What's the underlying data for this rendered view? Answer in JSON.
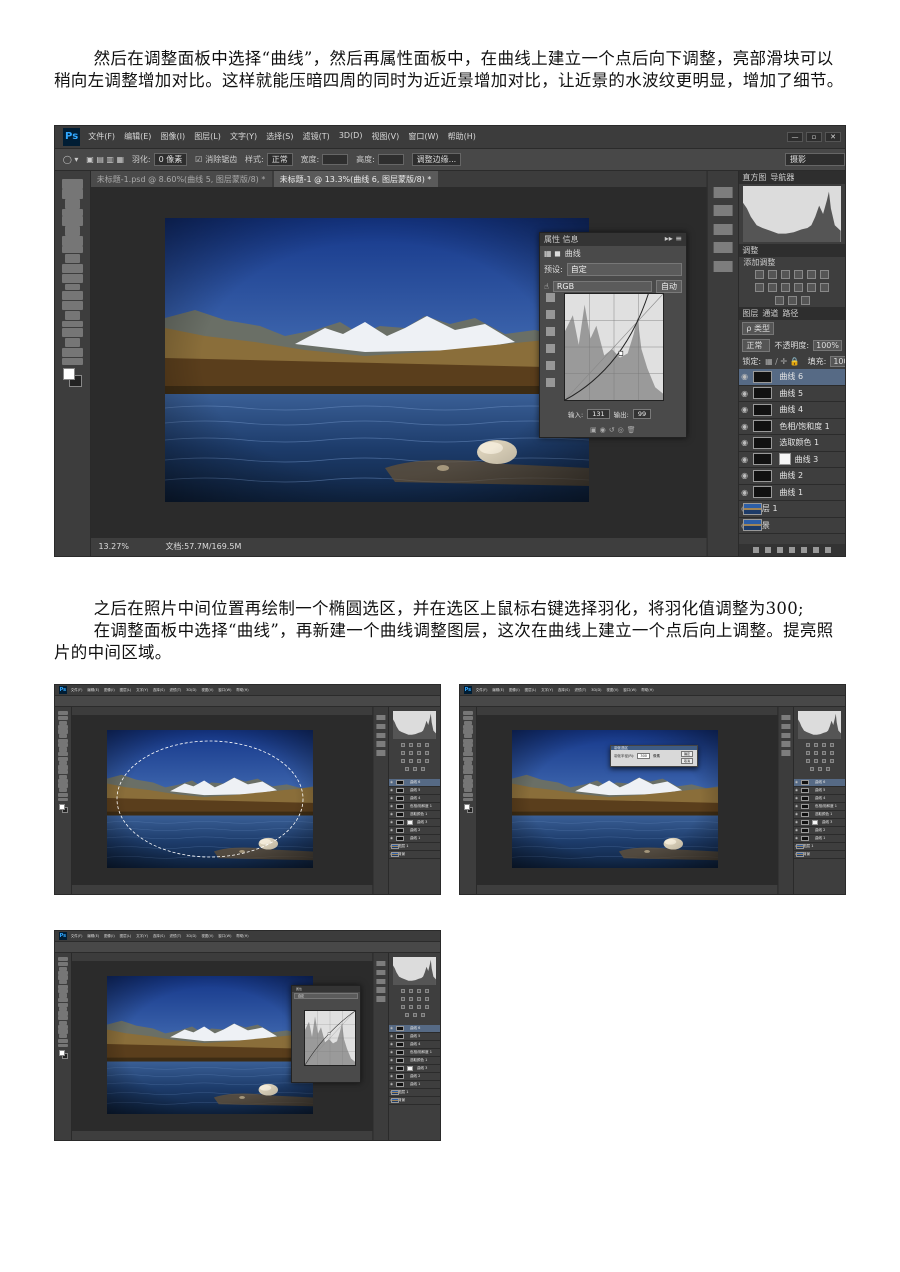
{
  "text": {
    "para1": "然后在调整面板中选择“曲线”，然后再属性面板中，在曲线上建立一个点后向下调整，亮部滑块可以稍向左调整增加对比。这样就能压暗四周的同时为近近景增加对比，让近景的水波纹更明显，增加了细节。",
    "para2_line1": "之后在照片中间位置再绘制一个椭圆选区，并在选区上鼠标右键选择羽化，将羽化值调整为300;",
    "para2_line2": "在调整面板中选择“曲线”，再新建一个曲线调整图层，这次在曲线上建立一个点后向上调整。提亮照片的中间区域。"
  },
  "app": {
    "logo": "Ps",
    "menus": [
      "文件(F)",
      "编辑(E)",
      "图像(I)",
      "图层(L)",
      "文字(Y)",
      "选择(S)",
      "滤镜(T)",
      "3D(D)",
      "视图(V)",
      "窗口(W)",
      "帮助(H)"
    ],
    "window_controls": [
      "—",
      "▫",
      "✕"
    ],
    "options": {
      "feather_label": "羽化:",
      "feather_value": "0 像素",
      "antialias": "消除锯齿",
      "style_label": "样式:",
      "style_value": "正常",
      "width_label": "宽度:",
      "height_label": "高度:",
      "refine_edge": "调整边缘...",
      "workspace": "摄影"
    },
    "tabs": [
      "未标题-1.psd @ 8.60%(曲线 5, 图层蒙版/8) *",
      "未标题-1 @ 13.3%(曲线 6, 图层蒙版/8) *"
    ],
    "status": {
      "zoom": "13.27%",
      "doc": "文档:57.7M/169.5M"
    },
    "panels": {
      "histogram_tabs": [
        "直方图",
        "导航器"
      ],
      "adjust_tab": "调整",
      "adjust_title": "添加调整",
      "layers_tabs": [
        "图层",
        "通道",
        "路径"
      ],
      "kind": "ρ 类型",
      "blend": "正常",
      "opacity_label": "不透明度:",
      "opacity": "100%",
      "lock_label": "锁定:",
      "fill_label": "填充:",
      "fill": "100%"
    },
    "layers": [
      {
        "name": "曲线 6",
        "thumb": "dark",
        "mask": false,
        "selected": true
      },
      {
        "name": "曲线 5",
        "thumb": "dark",
        "mask": false,
        "selected": false
      },
      {
        "name": "曲线 4",
        "thumb": "dark",
        "mask": false,
        "selected": false
      },
      {
        "name": "色相/饱和度 1",
        "thumb": "dark",
        "mask": false,
        "selected": false
      },
      {
        "name": "选取颜色 1",
        "thumb": "dark",
        "mask": false,
        "selected": false
      },
      {
        "name": "曲线 3",
        "thumb": "dark",
        "mask": true,
        "selected": false
      },
      {
        "name": "曲线 2",
        "thumb": "dark",
        "mask": false,
        "selected": false
      },
      {
        "name": "曲线 1",
        "thumb": "dark",
        "mask": false,
        "selected": false
      },
      {
        "name": "图层 1",
        "thumb": "photo",
        "mask": false,
        "selected": false
      },
      {
        "name": "背景",
        "thumb": "photo",
        "mask": false,
        "selected": false
      }
    ],
    "properties": {
      "tabs": [
        "属性",
        "信息"
      ],
      "title": "曲线",
      "preset_label": "预设:",
      "preset_value": "自定",
      "channel_value": "RGB",
      "auto_button": "自动",
      "input_label": "输入:",
      "input_value": "131",
      "output_label": "输出:",
      "output_value": "99"
    },
    "feather_dialog": {
      "title": "羽化选区",
      "label": "羽化半径(R):",
      "value": "300",
      "unit": "像素",
      "ok": "确定",
      "cancel": "取消"
    }
  }
}
